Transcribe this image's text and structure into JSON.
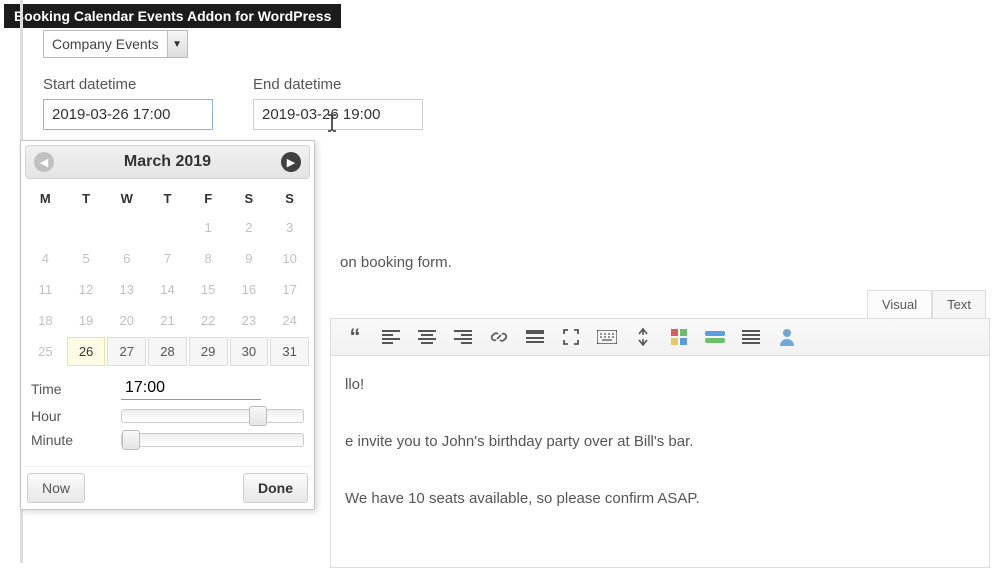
{
  "titlebar": "Booking Calendar Events Addon for WordPress",
  "category_select": {
    "value": "Company Events"
  },
  "start": {
    "label": "Start datetime",
    "value": "2019-03-26 17:00"
  },
  "end": {
    "label": "End datetime",
    "value": "2019-03-26 19:00"
  },
  "datepicker": {
    "month_title": "March 2019",
    "dow": [
      "M",
      "T",
      "W",
      "T",
      "F",
      "S",
      "S"
    ],
    "weeks": [
      [
        {
          "n": "",
          "cls": "empty"
        },
        {
          "n": "",
          "cls": "empty"
        },
        {
          "n": "",
          "cls": "empty"
        },
        {
          "n": "",
          "cls": "empty"
        },
        {
          "n": "1",
          "cls": "past"
        },
        {
          "n": "2",
          "cls": "past"
        },
        {
          "n": "3",
          "cls": "past"
        }
      ],
      [
        {
          "n": "4",
          "cls": "past"
        },
        {
          "n": "5",
          "cls": "past"
        },
        {
          "n": "6",
          "cls": "past"
        },
        {
          "n": "7",
          "cls": "past"
        },
        {
          "n": "8",
          "cls": "past"
        },
        {
          "n": "9",
          "cls": "past"
        },
        {
          "n": "10",
          "cls": "past"
        }
      ],
      [
        {
          "n": "11",
          "cls": "past"
        },
        {
          "n": "12",
          "cls": "past"
        },
        {
          "n": "13",
          "cls": "past"
        },
        {
          "n": "14",
          "cls": "past"
        },
        {
          "n": "15",
          "cls": "past"
        },
        {
          "n": "16",
          "cls": "past"
        },
        {
          "n": "17",
          "cls": "past"
        }
      ],
      [
        {
          "n": "18",
          "cls": "past"
        },
        {
          "n": "19",
          "cls": "past"
        },
        {
          "n": "20",
          "cls": "past"
        },
        {
          "n": "21",
          "cls": "past"
        },
        {
          "n": "22",
          "cls": "past"
        },
        {
          "n": "23",
          "cls": "past"
        },
        {
          "n": "24",
          "cls": "past"
        }
      ],
      [
        {
          "n": "25",
          "cls": "past"
        },
        {
          "n": "26",
          "cls": "today"
        },
        {
          "n": "27",
          "cls": "avail"
        },
        {
          "n": "28",
          "cls": "avail"
        },
        {
          "n": "29",
          "cls": "avail"
        },
        {
          "n": "30",
          "cls": "avail"
        },
        {
          "n": "31",
          "cls": "avail"
        }
      ]
    ],
    "time_label": "Time",
    "time_value": "17:00",
    "hour_label": "Hour",
    "minute_label": "Minute",
    "hour_pos_pct": 70,
    "minute_pos_pct": 0,
    "now_label": "Now",
    "done_label": "Done"
  },
  "hint_text": "on booking form.",
  "editor": {
    "tabs": {
      "visual": "Visual",
      "text": "Text"
    },
    "body": {
      "line1": "llo!",
      "line2": "e invite you to John's birthday party over at Bill's bar.",
      "line3": "We have 10 seats available, so please confirm ASAP."
    }
  }
}
